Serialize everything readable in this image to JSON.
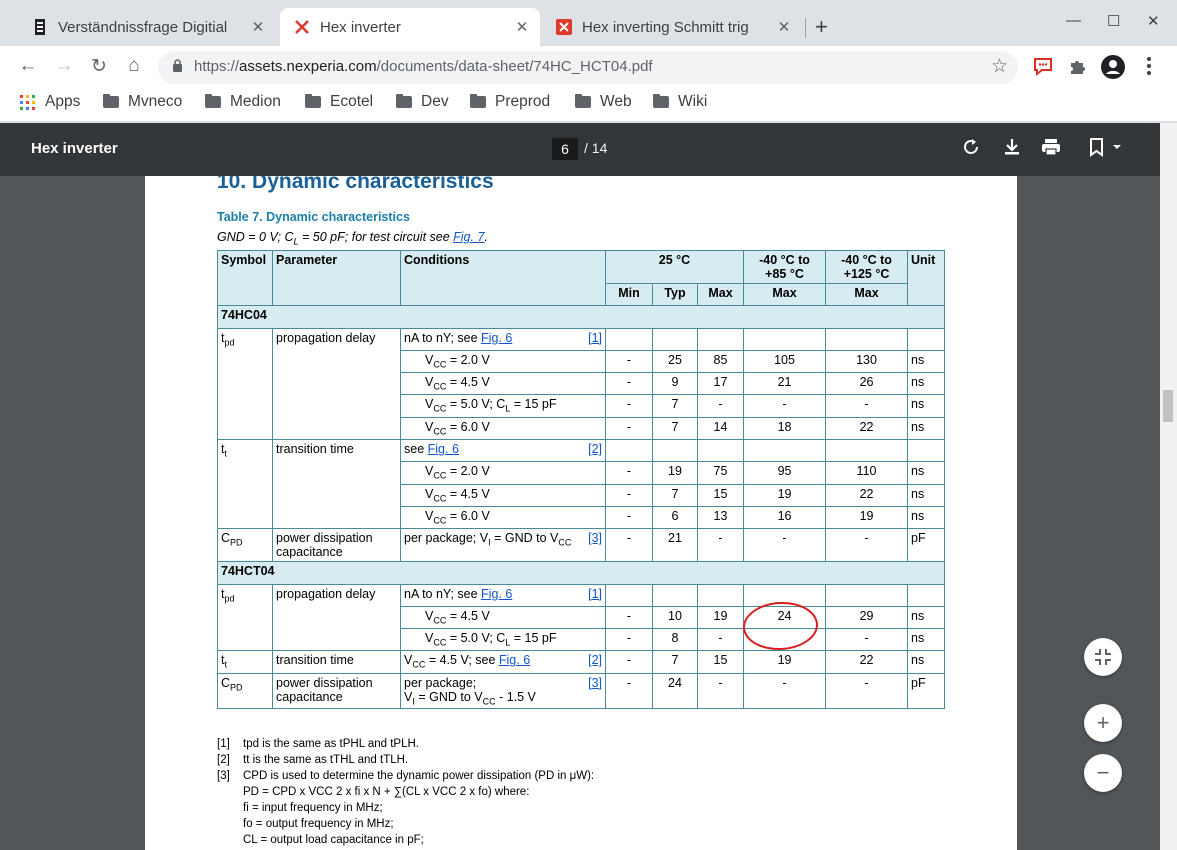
{
  "tabs": [
    {
      "title": "Verständnissfrage Digitial",
      "close": "✕"
    },
    {
      "title": "Hex inverter",
      "close": "✕"
    },
    {
      "title": "Hex inverting Schmitt trig",
      "close": "✕"
    }
  ],
  "new_tab": "+",
  "window": {
    "minimize": "—",
    "maximize": "☐",
    "close": "✕"
  },
  "toolbar": {
    "back": "←",
    "forward": "→",
    "reload": "↻",
    "home": "⌂",
    "url_prefix": "https://",
    "url_domain": "assets.nexperia.com",
    "url_path": "/documents/data-sheet/74HC_HCT04.pdf",
    "star": "☆"
  },
  "bookmarks": [
    "Apps",
    "Mvneco",
    "Medion",
    "Ecotel",
    "Dev",
    "Preprod",
    "Web",
    "Wiki"
  ],
  "pdf": {
    "title": "Hex inverter",
    "page": "6",
    "total": "/ 14"
  },
  "doc": {
    "section": "10.  Dynamic characteristics",
    "table_title": "Table 7. Dynamic characteristics",
    "conditions_prefix": "GND = 0 V; C",
    "conditions_sub": "L",
    "conditions_mid": " = 50 pF; for test circuit see ",
    "conditions_link": "Fig. 7",
    "conditions_end": ".",
    "headers": {
      "symbol": "Symbol",
      "parameter": "Parameter",
      "conditions": "Conditions",
      "t25": "25 °C",
      "t85": "-40 °C to +85 °C",
      "t125": "-40 °C to +125 °C",
      "unit": "Unit",
      "min": "Min",
      "typ": "Typ",
      "max": "Max",
      "max85": "Max",
      "max125": "Max"
    },
    "groups": [
      "74HC04",
      "74HCT04"
    ],
    "fig6": "Fig. 6",
    "notes": [
      {
        "num": "[1]",
        "text": "tpd is the same as tPHL and tPLH."
      },
      {
        "num": "[2]",
        "text": "tt is the same as tTHL and tTLH."
      },
      {
        "num": "[3]",
        "text": "CPD is used to determine the dynamic power dissipation (PD in μW):"
      },
      {
        "num": "",
        "text": "PD = CPD x VCC 2 x fi x N + ∑(CL x VCC 2 x fo) where:"
      },
      {
        "num": "",
        "text": "fi = input frequency in MHz;"
      },
      {
        "num": "",
        "text": "fo = output frequency in MHz;"
      },
      {
        "num": "",
        "text": "CL = output load capacitance in pF;"
      }
    ]
  },
  "fab": {
    "fit": "⤡",
    "zoom_in": "+",
    "zoom_out": "−"
  }
}
